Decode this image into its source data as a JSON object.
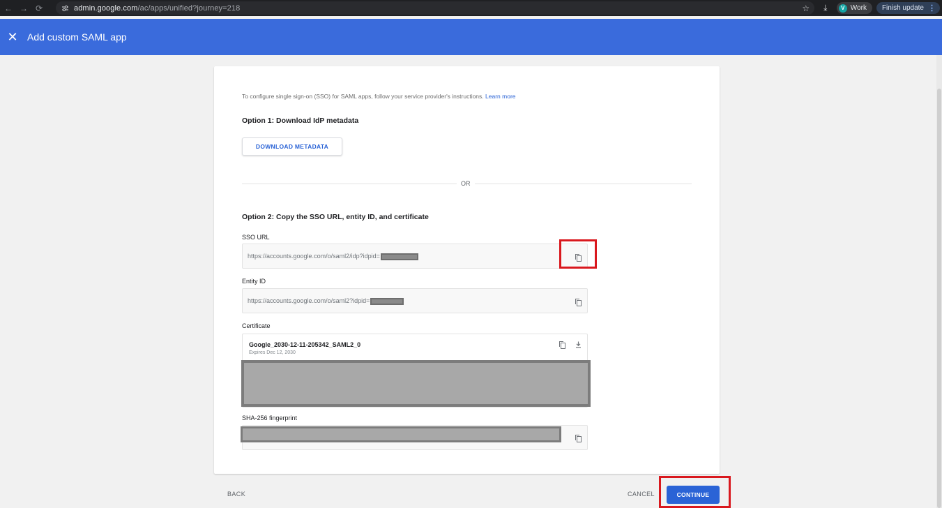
{
  "browser": {
    "url_host": "admin.google.com",
    "url_path": "/ac/apps/unified?journey=218",
    "profile_initial": "V",
    "profile_label": "Work",
    "update_label": "Finish update",
    "icons": [
      "back-arrow-icon",
      "forward-arrow-icon",
      "reload-icon",
      "site-settings-icon",
      "star-icon",
      "download-icon",
      "menu-kebab-icon"
    ]
  },
  "appbar": {
    "title": "Add custom SAML app",
    "background": "#3a6bdc"
  },
  "card": {
    "intro_text": "To configure single sign-on (SSO) for SAML apps, follow your service provider's instructions.",
    "learn_more": "Learn more",
    "option1_title": "Option 1: Download IdP metadata",
    "download_button": "DOWNLOAD METADATA",
    "or_label": "OR",
    "option2_title": "Option 2: Copy the SSO URL, entity ID, and certificate",
    "sso_url": {
      "label": "SSO URL",
      "value": "https://accounts.google.com/o/saml2/idp?idpid="
    },
    "entity_id": {
      "label": "Entity ID",
      "value": "https://accounts.google.com/o/saml2?idpid="
    },
    "certificate": {
      "label": "Certificate",
      "name": "Google_2030-12-11-205342_SAML2_0",
      "expires": "Expires Dec 12, 2030"
    },
    "fingerprint": {
      "label": "SHA-256 fingerprint"
    }
  },
  "footer": {
    "back": "BACK",
    "cancel": "CANCEL",
    "continue": "CONTINUE"
  },
  "colors": {
    "accent": "#2a63d6",
    "highlight": "#d9181e"
  }
}
